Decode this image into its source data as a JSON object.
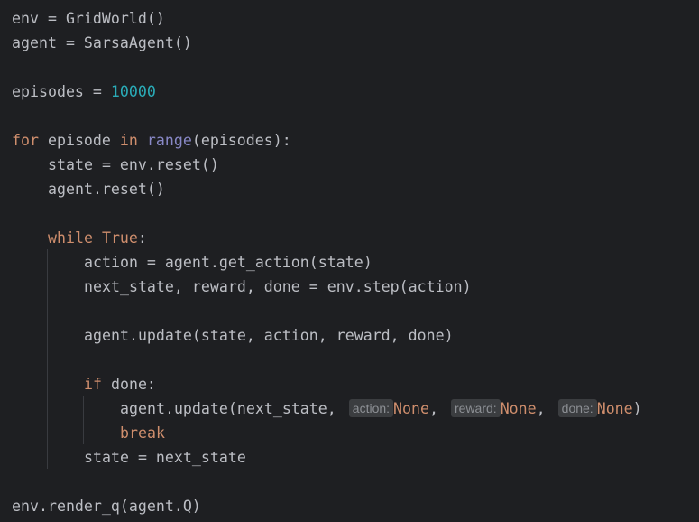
{
  "code": {
    "line1": {
      "a": "env = GridWorld()"
    },
    "line2": {
      "a": "agent = SarsaAgent()"
    },
    "line4": {
      "a": "episodes = ",
      "num": "10000"
    },
    "line6": {
      "kw1": "for",
      "a": " episode ",
      "kw2": "in",
      "sp": " ",
      "bi": "range",
      "b": "(episodes):"
    },
    "line7": {
      "a": "state = env.reset()"
    },
    "line8": {
      "a": "agent.reset()"
    },
    "line10": {
      "kw1": "while",
      "sp": " ",
      "kw2": "True",
      "b": ":"
    },
    "line11": {
      "a": "action = agent.get_action(state)"
    },
    "line12": {
      "a": "next_state, reward, done = env.step(action)"
    },
    "line14": {
      "a": "agent.update(state, action, reward, done)"
    },
    "line16": {
      "kw": "if",
      "a": " done:"
    },
    "line17": {
      "a": "agent.update(next_state,",
      "hint1": "action:",
      "v1": "None",
      "c1": ",",
      "hint2": "reward:",
      "v2": "None",
      "c2": ",",
      "hint3": "done:",
      "v3": "None",
      "end": ")"
    },
    "line18": {
      "kw": "break"
    },
    "line19": {
      "a": "state = next_state"
    },
    "line21": {
      "a": "env.render_q(agent.Q)"
    }
  }
}
